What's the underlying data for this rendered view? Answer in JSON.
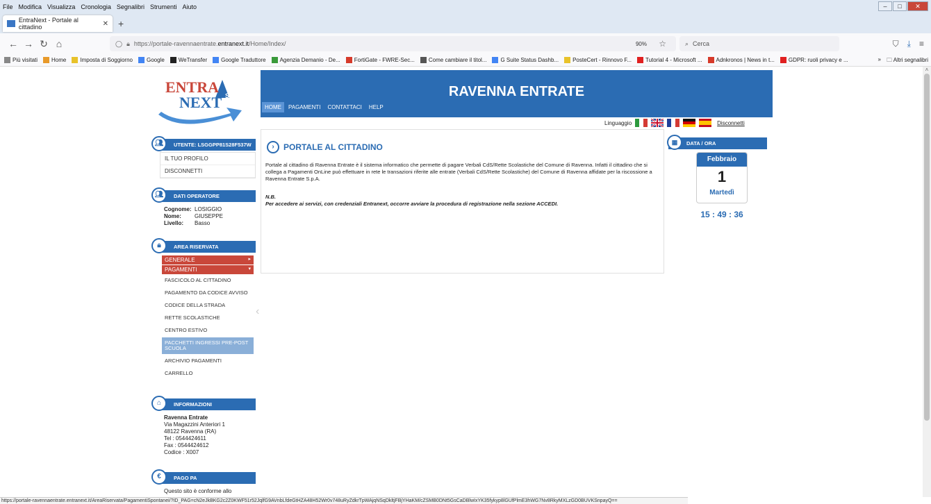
{
  "browser": {
    "menu": [
      "File",
      "Modifica",
      "Visualizza",
      "Cronologia",
      "Segnalibri",
      "Strumenti",
      "Aiuto"
    ],
    "tab_title": "EntraNext - Portale al cittadino",
    "url_prefix": "https://portale-ravennaentrate.",
    "url_domain": "entranext.it",
    "url_path": "/Home/Index/",
    "zoom": "90%",
    "search_placeholder": "Cerca",
    "bookmarks": [
      {
        "label": "Più visitati",
        "color": "#888888"
      },
      {
        "label": "Home",
        "color": "#e89a2a"
      },
      {
        "label": "Imposta di Soggiorno",
        "color": "#e8c22a"
      },
      {
        "label": "Google",
        "color": "#4285f4"
      },
      {
        "label": "WeTransfer",
        "color": "#222222"
      },
      {
        "label": "Google Traduttore",
        "color": "#4285f4"
      },
      {
        "label": "Agenzia Demanio - De...",
        "color": "#3a9a3a"
      },
      {
        "label": "FortiGate - FWRE-Sec...",
        "color": "#d63a2a"
      },
      {
        "label": "Come cambiare il titol...",
        "color": "#555555"
      },
      {
        "label": "G Suite Status Dashb...",
        "color": "#4285f4"
      },
      {
        "label": "PosteCert - Rinnovo F...",
        "color": "#e8c22a"
      },
      {
        "label": "Tutorial 4 - Microsoft ...",
        "color": "#e02020"
      },
      {
        "label": "Adnkronos | News in t...",
        "color": "#d63a2a"
      },
      {
        "label": "GDPR: ruoli privacy e ...",
        "color": "#e02020"
      }
    ],
    "other_bookmarks": "Altri segnalibri",
    "status_url": "https://portale-ravennaentrate.entranext.it/AreaRiservata/PagamentiSpontanei/?ID_PAG=cN2eJkBKG2c2Z0KWF51r52JqlfG9AVnbLfdeGtHZA48H52Wr0v748uRyZdkrTpWAjqNSqDkltjFBjYHaKM/cZSMB0DNt5GsCaDBlwIxYK35fykyp8lGUfPlmE3hWG7Nv8RkyMXLzGD0BUVKSnpayQ=="
  },
  "site": {
    "logo_top": "ENTRA",
    "logo_suite": "SUITE",
    "logo_bottom": "NEXT",
    "header_title": "RAVENNA ENTRATE",
    "nav": [
      "HOME",
      "PAGAMENTI",
      "CONTATTACI",
      "HELP"
    ],
    "lang_label": "Linguaggio",
    "disconnect": "Disconnetti"
  },
  "sidebar": {
    "user_head": "UTENTE: LSGGPP81S28F537W",
    "user_links": [
      "IL TUO PROFILO",
      "DISCONNETTI"
    ],
    "operator_head": "DATI OPERATORE",
    "operator": [
      {
        "k": "Cognome:",
        "v": "LOSIGGIO"
      },
      {
        "k": "Nome:",
        "v": "GIUSEPPE"
      },
      {
        "k": "Livello:",
        "v": "Basso"
      }
    ],
    "reserved_head": "AREA RISERVATA",
    "generale": "GENERALE",
    "pagamenti": "PAGAMENTI",
    "payment_links": [
      "FASCICOLO AL CITTADINO",
      "PAGAMENTO DA CODICE AVVISO",
      "CODICE DELLA STRADA",
      "RETTE SCOLASTICHE",
      "CENTRO ESTIVO",
      "PACCHETTI INGRESSI PRE-POST SCUOLA",
      "ARCHIVIO PAGAMENTI",
      "CARRELLO"
    ],
    "info_head": "INFORMAZIONI",
    "info_name": "Ravenna Entrate",
    "info_lines": [
      "Via Magazzini Anteriori 1",
      "48122 Ravenna (RA)",
      "Tel : 0544424611",
      "Fax : 0544424612",
      "Codice : X007"
    ],
    "pagopa_head": "PAGO PA",
    "pagopa_text": "Questo sito è conforme allo"
  },
  "main": {
    "title": "PORTALE AL CITTADINO",
    "text": "Portale al cittadino di Ravenna Entrate è il sistema informatico che permette di pagare Verbali CdS/Rette Scolastiche del Comune di Ravenna. Infatti il cittadino che si collega a Pagamenti OnLine può effettuare in rete le transazioni riferite alle entrate (Verbali CdS/Rette Scolastiche) del Comune di Ravenna affidate per la riscossione a Ravenna Entrate S.p.A.",
    "nb_label": "N.B.",
    "nb_text": "Per accedere ai servizi, con credenziali Entranext, occorre avviare la procedura di registrazione nella sezione ACCEDI."
  },
  "datetime": {
    "head": "DATA / ORA",
    "month": "Febbraio",
    "day": "1",
    "weekday": "Martedì",
    "time": "15 : 49 : 36"
  }
}
